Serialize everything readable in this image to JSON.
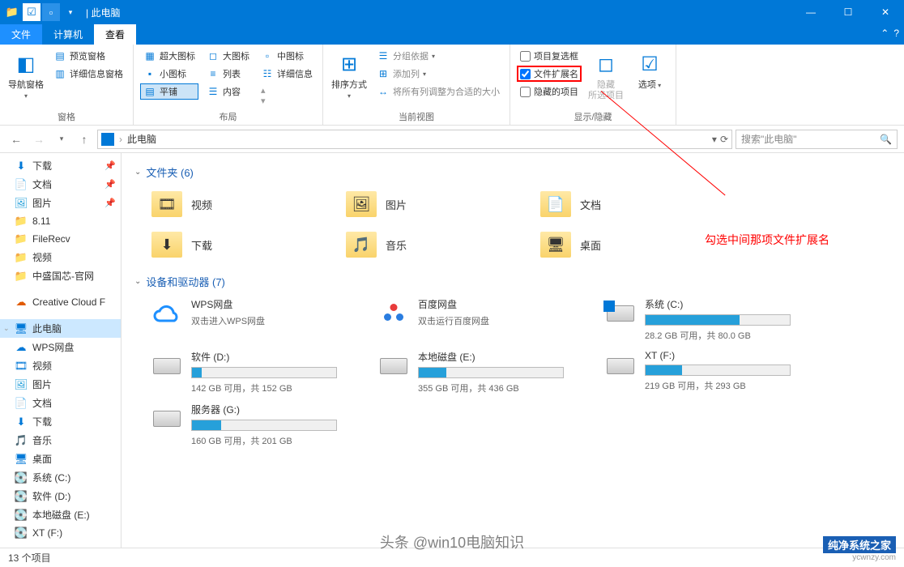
{
  "title": "此电脑",
  "tabs": {
    "file": "文件",
    "computer": "计算机",
    "view": "查看"
  },
  "ribbon": {
    "panes": {
      "nav_pane": "导航窗格",
      "preview": "预览窗格",
      "details_pane": "详细信息窗格",
      "group_label": "窗格"
    },
    "layout": {
      "xlarge": "超大图标",
      "large": "大图标",
      "medium": "中图标",
      "small": "小图标",
      "list": "列表",
      "details": "详细信息",
      "tiles": "平铺",
      "content": "内容",
      "group_label": "布局"
    },
    "view": {
      "sort": "排序方式",
      "group_by": "分组依据",
      "add_cols": "添加列",
      "size_cols": "将所有列调整为合适的大小",
      "group_label": "当前视图"
    },
    "showhide": {
      "chk_boxes": "项目复选框",
      "chk_ext": "文件扩展名",
      "chk_hidden": "隐藏的项目",
      "hide_sel": "隐藏\n所选项目",
      "options": "选项",
      "group_label": "显示/隐藏"
    }
  },
  "address": {
    "location": "此电脑",
    "search_placeholder": "搜索\"此电脑\""
  },
  "sidebar": [
    {
      "icon": "⬇",
      "color": "#0078d7",
      "label": "下载",
      "pin": true
    },
    {
      "icon": "📄",
      "color": "#555",
      "label": "文档",
      "pin": true
    },
    {
      "icon": "🖼",
      "color": "#26a0da",
      "label": "图片",
      "pin": true
    },
    {
      "icon": "📁",
      "color": "#f9d36b",
      "label": "8.11"
    },
    {
      "icon": "📁",
      "color": "#f9d36b",
      "label": "FileRecv"
    },
    {
      "icon": "📁",
      "color": "#f9d36b",
      "label": "视频"
    },
    {
      "icon": "📁",
      "color": "#f9d36b",
      "label": "中盛国芯-官网"
    },
    {
      "icon": "☁",
      "color": "#e05a00",
      "label": "Creative Cloud F",
      "gap": true
    },
    {
      "icon": "🖥",
      "color": "#0078d7",
      "label": "此电脑",
      "sel": true,
      "gap": true,
      "exp": true
    },
    {
      "icon": "☁",
      "color": "#0078d7",
      "label": "WPS网盘"
    },
    {
      "icon": "🎞",
      "color": "#0078d7",
      "label": "视频"
    },
    {
      "icon": "🖼",
      "color": "#26a0da",
      "label": "图片"
    },
    {
      "icon": "📄",
      "color": "#555",
      "label": "文档"
    },
    {
      "icon": "⬇",
      "color": "#0078d7",
      "label": "下载"
    },
    {
      "icon": "🎵",
      "color": "#0078d7",
      "label": "音乐"
    },
    {
      "icon": "🖥",
      "color": "#0078d7",
      "label": "桌面"
    },
    {
      "icon": "💽",
      "color": "#555",
      "label": "系统 (C:)"
    },
    {
      "icon": "💽",
      "color": "#555",
      "label": "软件 (D:)"
    },
    {
      "icon": "💽",
      "color": "#555",
      "label": "本地磁盘 (E:)"
    },
    {
      "icon": "💽",
      "color": "#555",
      "label": "XT (F:)"
    }
  ],
  "sections": {
    "folders_hdr": "文件夹 (6)",
    "folders": [
      {
        "ov": "🎞",
        "label": "视频"
      },
      {
        "ov": "🖼",
        "label": "图片"
      },
      {
        "ov": "📄",
        "label": "文档"
      },
      {
        "ov": "⬇",
        "label": "下载"
      },
      {
        "ov": "🎵",
        "label": "音乐"
      },
      {
        "ov": "🖥",
        "label": "桌面"
      }
    ],
    "drives_hdr": "设备和驱动器 (7)",
    "clouds": [
      {
        "icon": "cloud-blue",
        "name": "WPS网盘",
        "sub": "双击进入WPS网盘"
      },
      {
        "icon": "cloud-red",
        "name": "百度网盘",
        "sub": "双击运行百度网盘"
      }
    ],
    "drives": [
      {
        "name": "系统 (C:)",
        "free": "28.2 GB 可用，共 80.0 GB",
        "pct": 65,
        "os": true
      },
      {
        "name": "软件 (D:)",
        "free": "142 GB 可用，共 152 GB",
        "pct": 7
      },
      {
        "name": "本地磁盘 (E:)",
        "free": "355 GB 可用，共 436 GB",
        "pct": 19
      },
      {
        "name": "XT (F:)",
        "free": "219 GB 可用，共 293 GB",
        "pct": 25
      },
      {
        "name": "服务器 (G:)",
        "free": "160 GB 可用，共 201 GB",
        "pct": 20
      }
    ]
  },
  "status": "13 个项目",
  "annotation": "勾选中间那项文件扩展名",
  "watermark1": "头条 @win10电脑知识",
  "watermark2": {
    "l1": "纯净系统之家",
    "l2": "ycwnzy.com"
  }
}
